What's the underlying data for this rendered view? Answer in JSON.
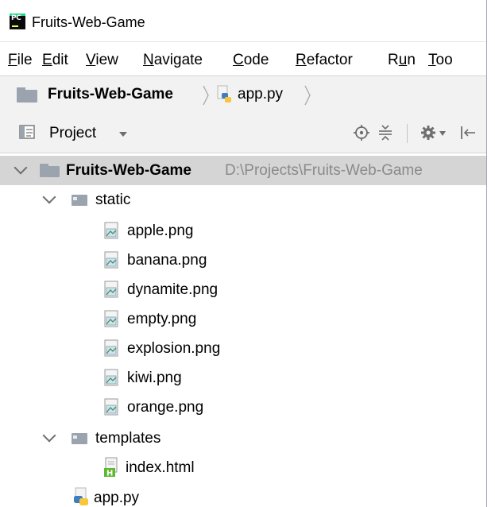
{
  "window": {
    "app_logo_text": "PC",
    "title": "Fruits-Web-Game"
  },
  "menu": {
    "items": [
      {
        "mnemonic": "F",
        "rest": "ile"
      },
      {
        "mnemonic": "E",
        "rest": "dit"
      },
      {
        "mnemonic": "V",
        "rest": "iew"
      },
      {
        "mnemonic": "N",
        "rest": "avigate"
      },
      {
        "mnemonic": "C",
        "rest": "ode"
      },
      {
        "mnemonic": "R",
        "rest": "efactor"
      },
      {
        "pre": "R",
        "mnemonic": "u",
        "rest": "n"
      },
      {
        "mnemonic": "T",
        "rest": "oo"
      }
    ]
  },
  "breadcrumbs": {
    "project": "Fruits-Web-Game",
    "file": "app.py"
  },
  "tool_window": {
    "title": "Project",
    "icons": [
      "locate-icon",
      "collapse-all-icon",
      "settings-icon",
      "hide-icon"
    ]
  },
  "tree": {
    "root": {
      "name": "Fruits-Web-Game",
      "path": "D:\\Projects\\Fruits-Web-Game"
    },
    "static": {
      "name": "static",
      "files": [
        "apple.png",
        "banana.png",
        "dynamite.png",
        "empty.png",
        "explosion.png",
        "kiwi.png",
        "orange.png"
      ]
    },
    "templates": {
      "name": "templates",
      "files": [
        "index.html"
      ]
    },
    "root_files": [
      "app.py"
    ]
  },
  "colors": {
    "selection": "#d5d5d5",
    "folder": "#9ba4ae",
    "python_blue": "#3f7cc0",
    "python_yellow": "#f7c63c",
    "html_green": "#5fb832"
  }
}
